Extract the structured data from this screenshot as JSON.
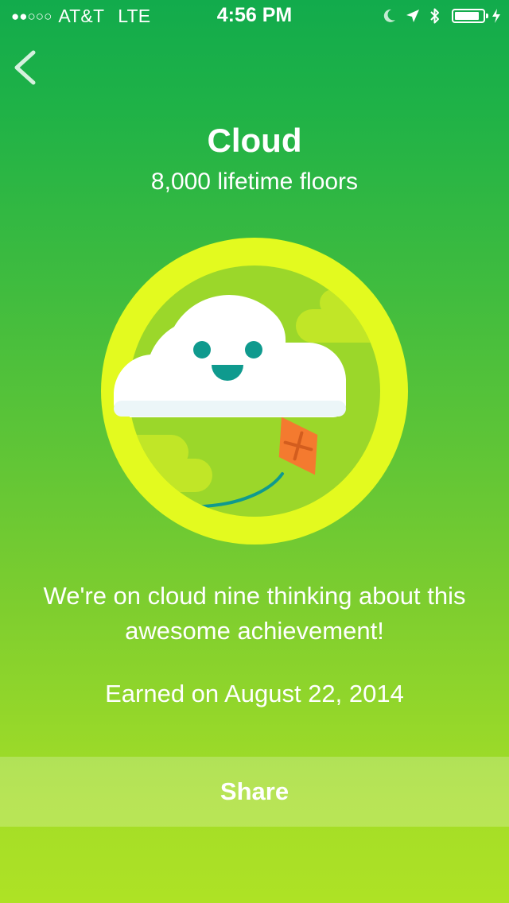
{
  "status_bar": {
    "signal": "●●○○○",
    "carrier": "AT&T",
    "network": "LTE",
    "time": "4:56 PM",
    "icons": [
      "moon-icon",
      "location-arrow-icon",
      "bluetooth-icon",
      "battery-icon",
      "charging-bolt-icon"
    ],
    "battery_level": 0.9
  },
  "navigation": {
    "back_icon": "chevron-left-icon"
  },
  "badge": {
    "title": "Cloud",
    "subtitle": "8,000 lifetime floors",
    "description": "We're on cloud nine thinking about this awesome achievement!",
    "earned": "Earned on August 22, 2014",
    "colors": {
      "ring": "#e3fa1f",
      "disc": "#9bd72a",
      "cloud": "#ffffff",
      "face": "#0f9a8e",
      "kite": "#f47a2f"
    }
  },
  "actions": {
    "share_label": "Share"
  }
}
